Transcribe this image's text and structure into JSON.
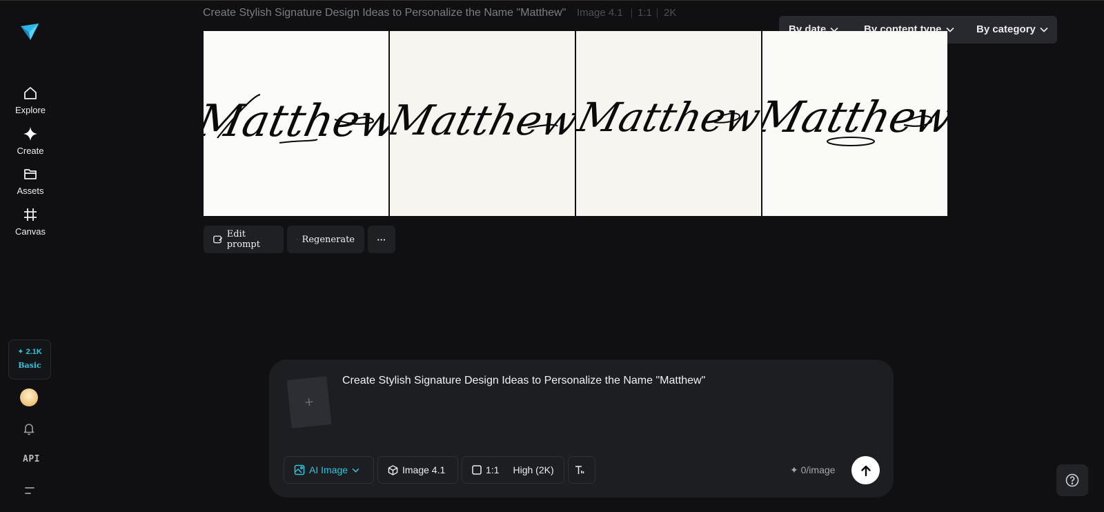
{
  "header": {
    "prompt_title": "Create Stylish Signature Design Ideas to Personalize the Name \"Matthew\"",
    "model": "Image 4.1",
    "ratio": "1:1",
    "resolution": "2K"
  },
  "filters": {
    "by_date": "By date",
    "by_content_type": "By content type",
    "by_category": "By category"
  },
  "sidebar": {
    "logo": "app-logo",
    "items": [
      {
        "label": "Explore",
        "icon": "home-icon"
      },
      {
        "label": "Create",
        "icon": "sparkle-icon"
      },
      {
        "label": "Assets",
        "icon": "folder-icon"
      },
      {
        "label": "Canvas",
        "icon": "frame-icon"
      }
    ],
    "credits": {
      "amount": "✦ 2.1K",
      "plan": "Basic"
    },
    "api_label": "API"
  },
  "images": [
    {
      "signature": "Matthew"
    },
    {
      "signature": "Matthew"
    },
    {
      "signature": "Matthew"
    },
    {
      "signature": "Matthew"
    }
  ],
  "actions": {
    "edit_prompt": "Edit prompt",
    "regenerate": "Regenerate",
    "more": "···"
  },
  "composer": {
    "upload_symbol": "+",
    "prompt_text": "Create Stylish Signature Design Ideas to Personalize the Name \"Matthew\"",
    "mode": "AI Image",
    "model": "Image 4.1",
    "ratio": "1:1",
    "quality": "High (2K)",
    "cost": "✦ 0/image"
  },
  "colors": {
    "background": "#101012",
    "accent": "#2cc6dc",
    "panel": "#1d1e22"
  }
}
